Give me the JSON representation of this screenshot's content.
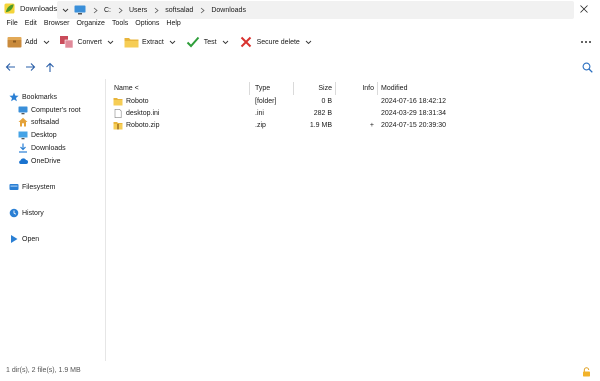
{
  "window": {
    "title": "Downloads"
  },
  "menu": [
    "File",
    "Edit",
    "Browser",
    "Organize",
    "Tools",
    "Options",
    "Help"
  ],
  "toolbar": {
    "add_label": "Add",
    "convert_label": "Convert",
    "extract_label": "Extract",
    "test_label": "Test",
    "secure_delete_label": "Secure delete"
  },
  "address": {
    "crumbs": [
      "C:",
      "Users",
      "softsalad",
      "Downloads"
    ]
  },
  "sidebar": {
    "bookmarks": "Bookmarks",
    "items": [
      {
        "label": "Computer's root",
        "icon": "computer-icon"
      },
      {
        "label": "softsalad",
        "icon": "home-icon"
      },
      {
        "label": "Desktop",
        "icon": "desktop-icon"
      },
      {
        "label": "Downloads",
        "icon": "download-icon"
      },
      {
        "label": "OneDrive",
        "icon": "cloud-icon"
      }
    ],
    "filesystem": "Filesystem",
    "history": "History",
    "open": "Open"
  },
  "columns": {
    "name": "Name <",
    "type": "Type",
    "size": "Size",
    "info": "Info",
    "modified": "Modified"
  },
  "files": [
    {
      "name": "Roboto",
      "type": "[folder]",
      "size": "0 B",
      "info": "",
      "modified": "2024-07-16 18:42:12",
      "icon": "folder-icon"
    },
    {
      "name": "desktop.ini",
      "type": ".ini",
      "size": "282 B",
      "info": "",
      "modified": "2024-03-29 18:31:34",
      "icon": "file-icon"
    },
    {
      "name": "Roboto.zip",
      "type": ".zip",
      "size": "1.9 MB",
      "info": "+",
      "modified": "2024-07-15 20:39:30",
      "icon": "zip-folder-icon"
    }
  ],
  "status": {
    "text": "1 dir(s), 2 file(s), 1.9 MB"
  },
  "colors": {
    "accent": "#2a7fd4",
    "folder": "#f2c14e",
    "check": "#2e9e3a",
    "delete": "#d8322e",
    "app": "#6fb33b"
  }
}
